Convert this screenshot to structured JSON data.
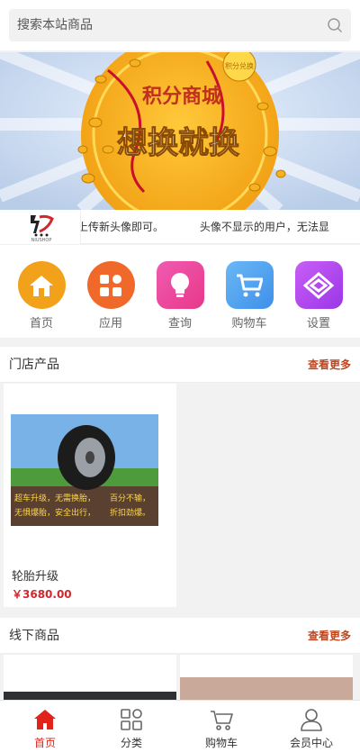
{
  "search": {
    "placeholder": "搜索本站商品"
  },
  "banner": {
    "line1": "积分商城",
    "line2": "想换就换",
    "badge": "积分兑换"
  },
  "notice": {
    "logo_text": "NIUSHOP",
    "text1": "上传新头像即可。",
    "text2": "头像不显示的用户，无法显"
  },
  "nav": [
    {
      "label": "首页",
      "icon": "home-icon",
      "color": "#f2a21a"
    },
    {
      "label": "应用",
      "icon": "apps-icon",
      "color": "#f0692b"
    },
    {
      "label": "查询",
      "icon": "bulb-icon",
      "color": "#ea4aa0"
    },
    {
      "label": "购物车",
      "icon": "cart-icon",
      "color": "#4aa6f0"
    },
    {
      "label": "设置",
      "icon": "diamond-icon",
      "color": "#b347f0"
    }
  ],
  "store_section": {
    "title": "门店产品",
    "more": "查看更多",
    "products": [
      {
        "name": "轮胎升级",
        "price": "￥3680.00",
        "image_text": [
          "超车升级，无需换胎，",
          "无惧爆胎，安全出行，"
        ],
        "image_text_b": [
          "百分不输，",
          "折扣劲爆。"
        ]
      }
    ]
  },
  "offline_section": {
    "title": "线下商品",
    "more": "查看更多"
  },
  "tabbar": [
    {
      "label": "首页",
      "icon": "home-icon",
      "active": true
    },
    {
      "label": "分类",
      "icon": "category-icon",
      "active": false
    },
    {
      "label": "购物车",
      "icon": "cart-icon",
      "active": false
    },
    {
      "label": "会员中心",
      "icon": "user-icon",
      "active": false
    }
  ],
  "colors": {
    "accent": "#e2231a",
    "more_link": "#c0461f",
    "price": "#d0282e"
  }
}
